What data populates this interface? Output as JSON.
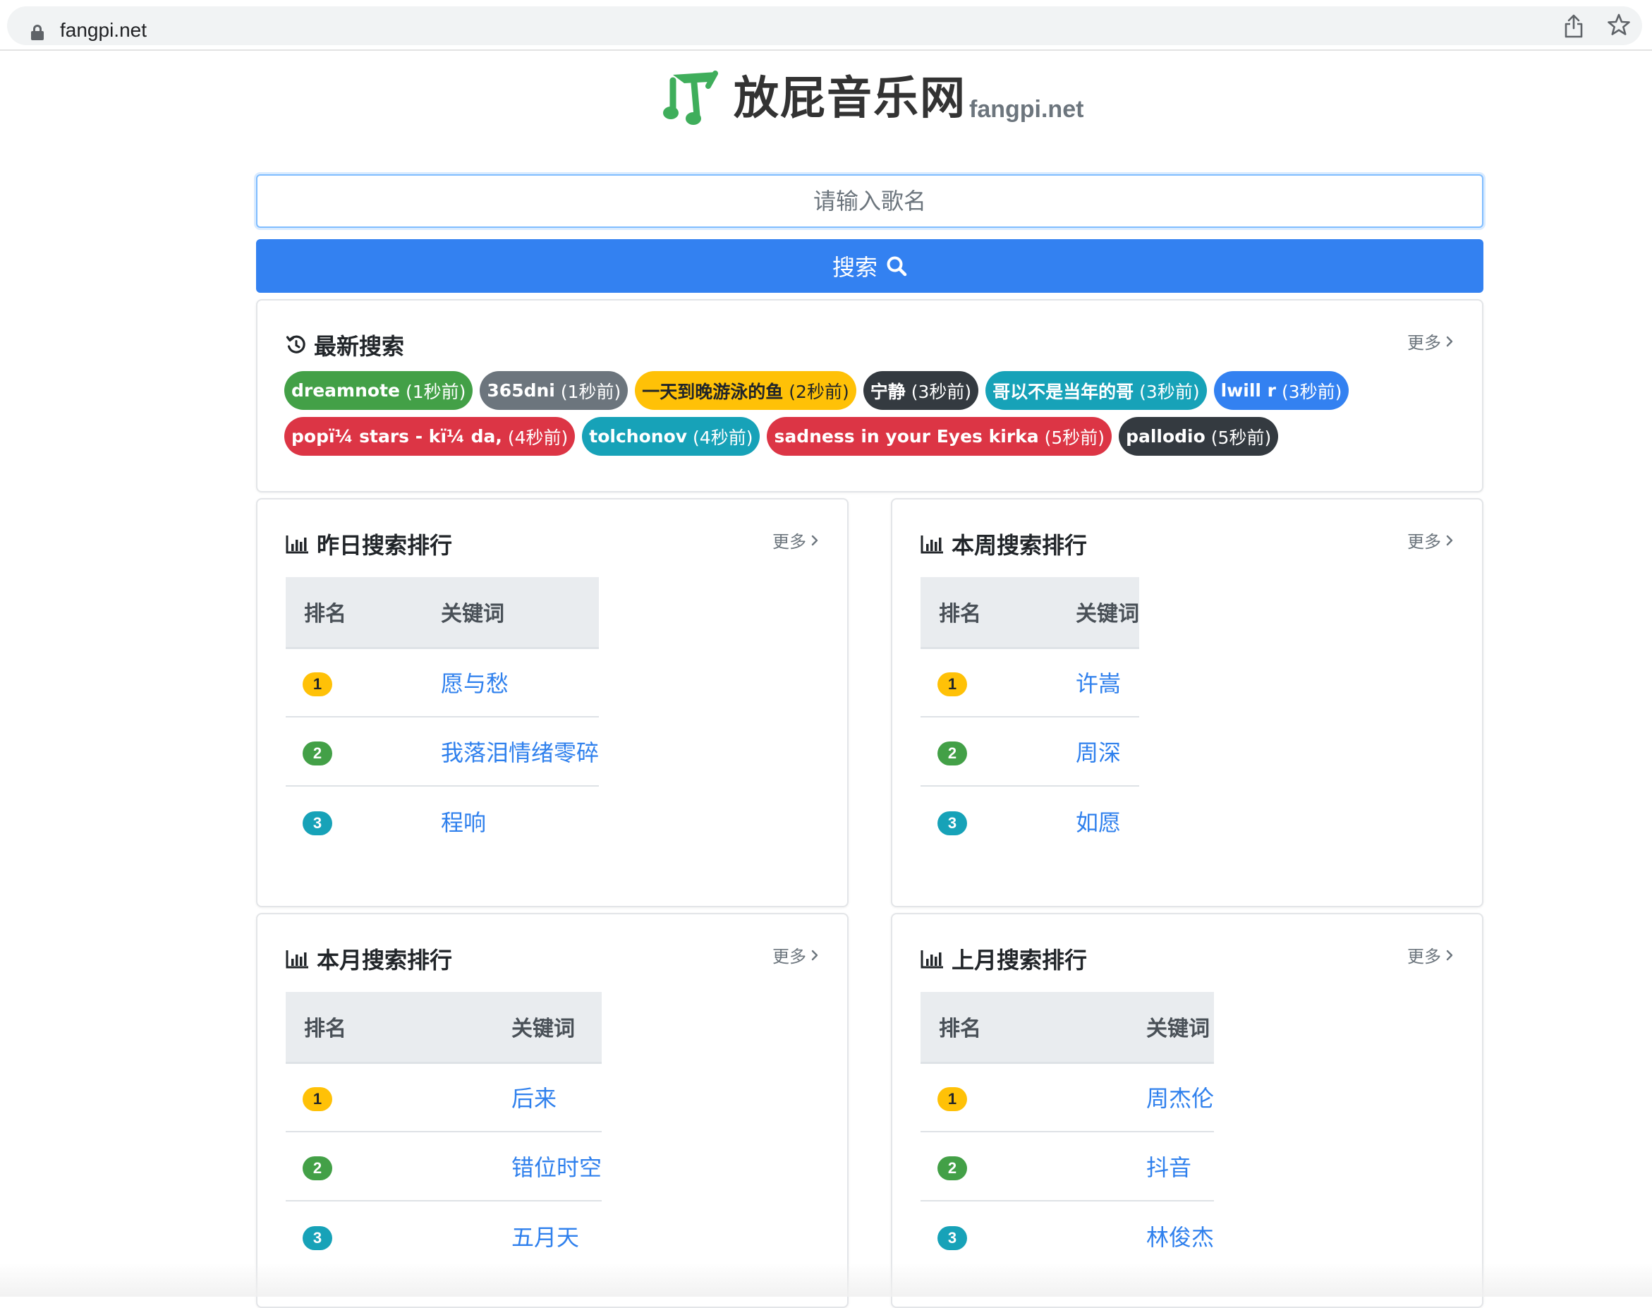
{
  "browser": {
    "url": "fangpi.net"
  },
  "header": {
    "title": "放屁音乐网",
    "subtitle": "fangpi.net"
  },
  "search": {
    "placeholder": "请输入歌名",
    "button_label": "搜索"
  },
  "recent": {
    "title": "最新搜索",
    "more_label": "更多",
    "tags": [
      {
        "keyword": "dreamnote",
        "time": "(1秒前)",
        "color": "#43a047"
      },
      {
        "keyword": "365dni",
        "time": "(1秒前)",
        "color": "#6c757d"
      },
      {
        "keyword": "一天到晚游泳的鱼",
        "time": "(2秒前)",
        "color": "#ffc107"
      },
      {
        "keyword": "宁静",
        "time": "(3秒前)",
        "color": "#343a40"
      },
      {
        "keyword": "哥以不是当年的哥",
        "time": "(3秒前)",
        "color": "#17a2b8"
      },
      {
        "keyword": "lwill r",
        "time": "(3秒前)",
        "color": "#3381f1"
      },
      {
        "keyword": "popï¼ stars - kï¼ da,",
        "time": "(4秒前)",
        "color": "#dc3545"
      },
      {
        "keyword": "tolchonov",
        "time": "(4秒前)",
        "color": "#17a2b8"
      },
      {
        "keyword": "sadness in your Eyes kirka",
        "time": "(5秒前)",
        "color": "#dc3545"
      },
      {
        "keyword": "pallodio",
        "time": "(5秒前)",
        "color": "#343a40"
      }
    ]
  },
  "rankings": [
    {
      "title": "昨日搜索排行",
      "more_label": "更多",
      "col_rank": "排名",
      "col_keyword": "关键词",
      "rows": [
        {
          "rank": "1",
          "keyword": "愿与愁"
        },
        {
          "rank": "2",
          "keyword": "我落泪情绪零碎"
        },
        {
          "rank": "3",
          "keyword": "程响"
        }
      ]
    },
    {
      "title": "本周搜索排行",
      "more_label": "更多",
      "col_rank": "排名",
      "col_keyword": "关键词",
      "rows": [
        {
          "rank": "1",
          "keyword": "许嵩"
        },
        {
          "rank": "2",
          "keyword": "周深"
        },
        {
          "rank": "3",
          "keyword": "如愿"
        }
      ]
    },
    {
      "title": "本月搜索排行",
      "more_label": "更多",
      "col_rank": "排名",
      "col_keyword": "关键词",
      "rows": [
        {
          "rank": "1",
          "keyword": "后来"
        },
        {
          "rank": "2",
          "keyword": "错位时空"
        },
        {
          "rank": "3",
          "keyword": "五月天"
        }
      ]
    },
    {
      "title": "上月搜索排行",
      "more_label": "更多",
      "col_rank": "排名",
      "col_keyword": "关键词",
      "rows": [
        {
          "rank": "1",
          "keyword": "周杰伦"
        },
        {
          "rank": "2",
          "keyword": "抖音"
        },
        {
          "rank": "3",
          "keyword": "林俊杰"
        }
      ]
    }
  ],
  "badge_colors": {
    "1": "#ffc107",
    "2": "#43a047",
    "3": "#17a2b8"
  }
}
